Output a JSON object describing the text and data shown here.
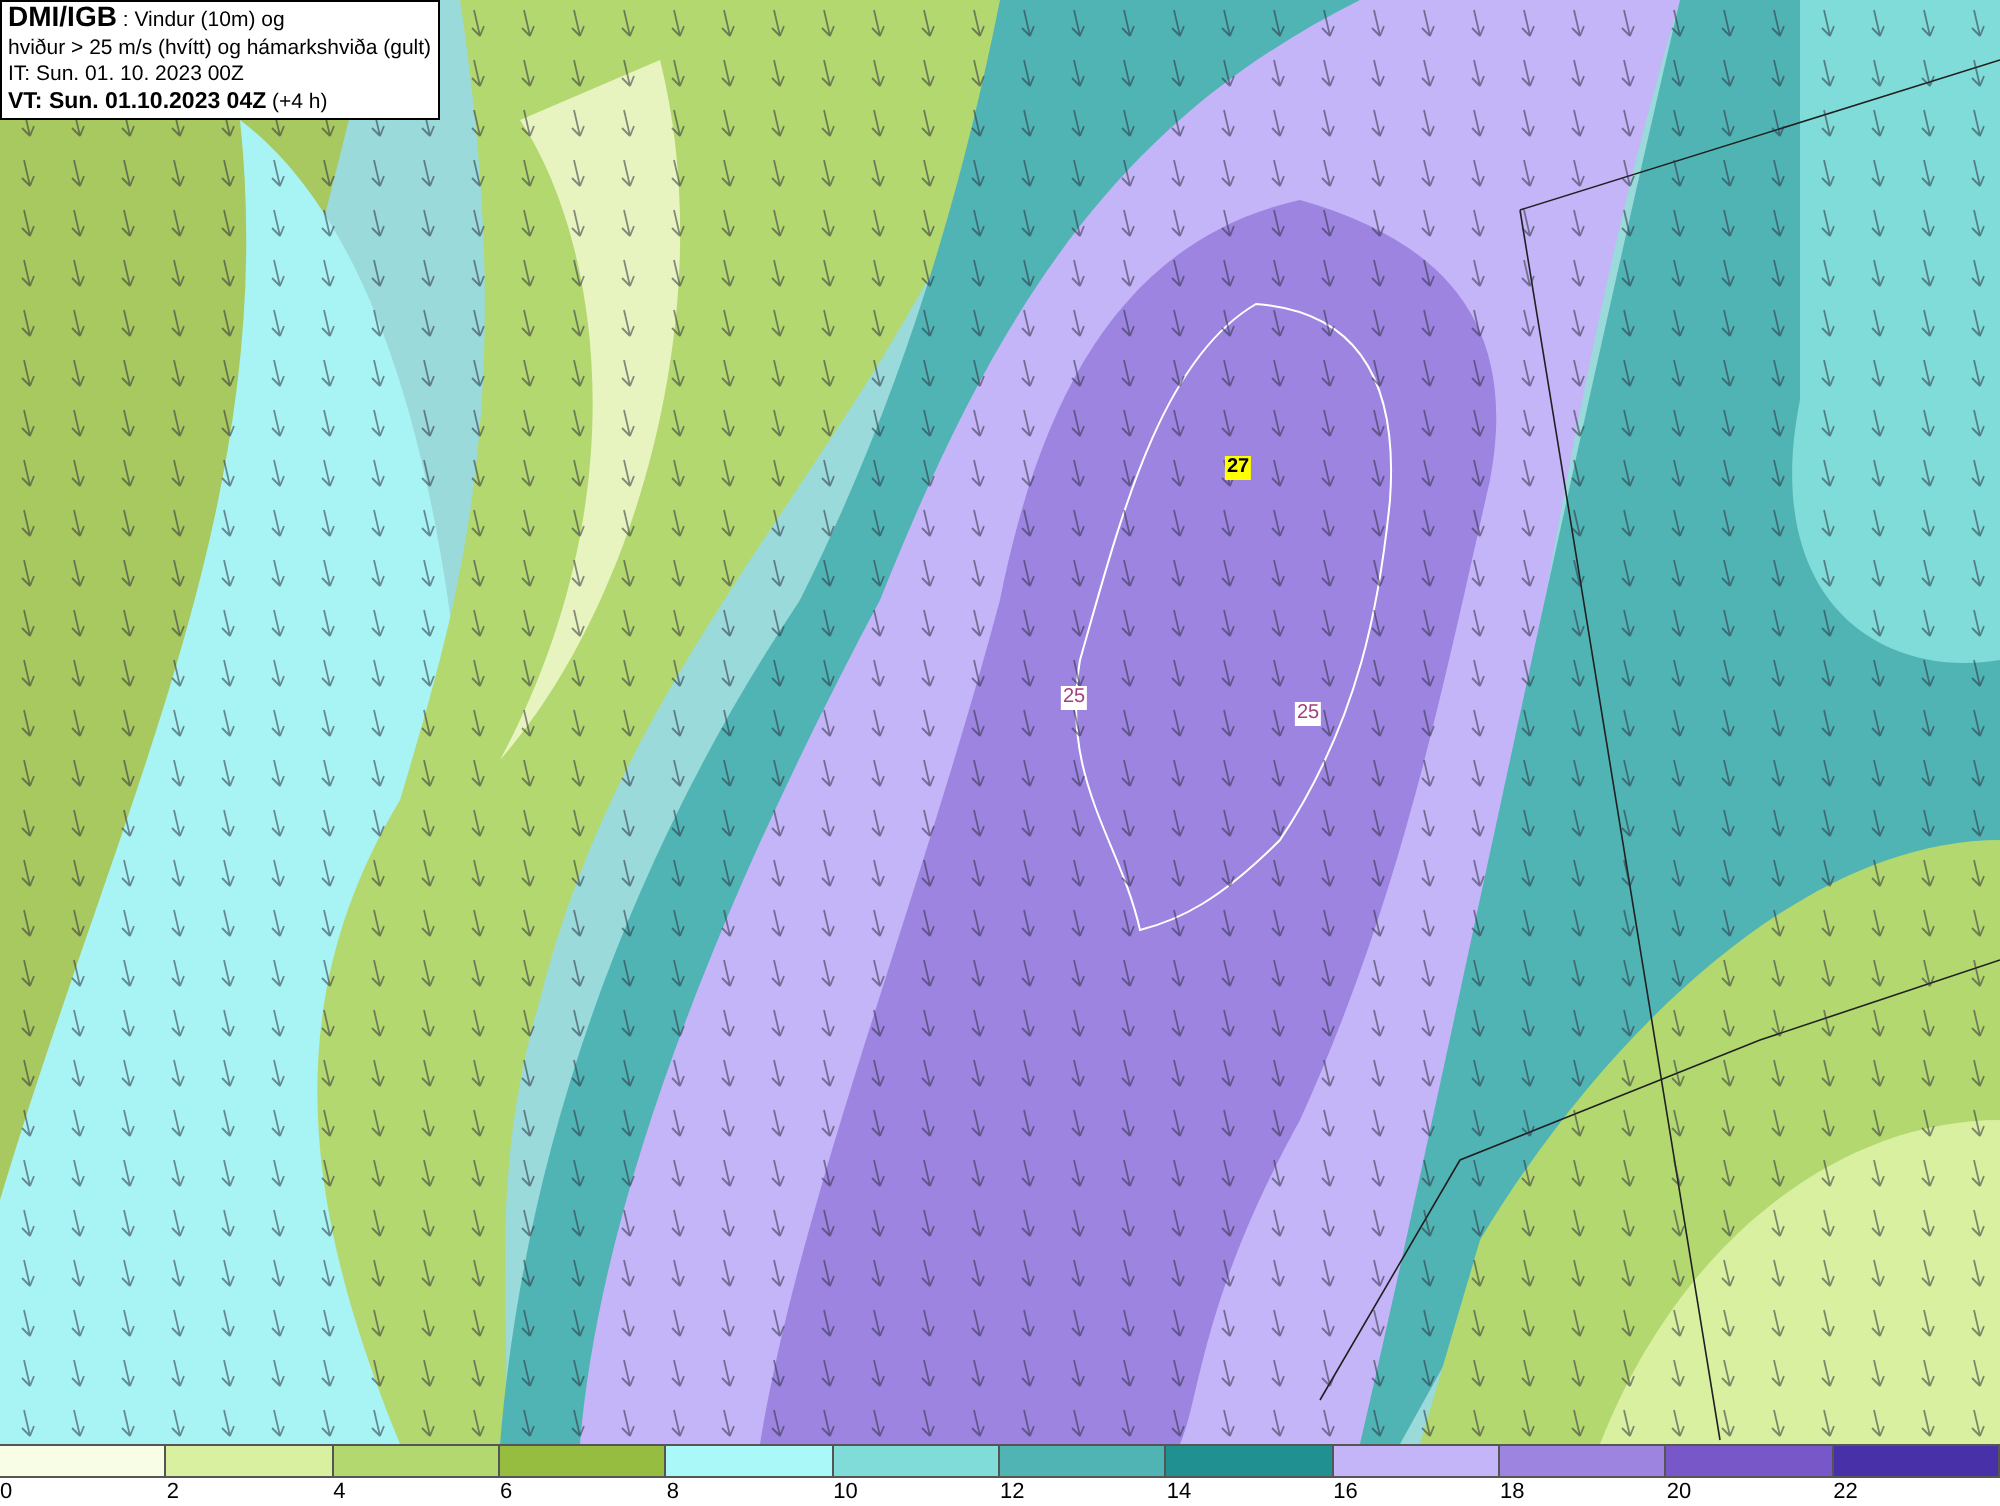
{
  "title_box": {
    "source": "DMI/IGB",
    "line_1": ": Vindur (10m) og",
    "line_2": "hviður > 25 m/s (hvítt) og hámarkshviða (gult)",
    "initial_time": "IT: Sun. 01. 10. 2023 00Z",
    "valid_time": "VT: Sun. 01.10.2023 04Z",
    "offset": "(+4 h)"
  },
  "map": {
    "labels": [
      {
        "text": "27",
        "kind": "max"
      },
      {
        "text": "25",
        "kind": "contour"
      },
      {
        "text": "25",
        "kind": "contour"
      }
    ]
  },
  "legend": {
    "items": [
      {
        "tick": "0",
        "color": "#f8fde6"
      },
      {
        "tick": "2",
        "color": "#d8f0a0"
      },
      {
        "tick": "4",
        "color": "#b4d870"
      },
      {
        "tick": "6",
        "color": "#96bc40"
      },
      {
        "tick": "8",
        "color": "#aaf8f8"
      },
      {
        "tick": "10",
        "color": "#80dcd8"
      },
      {
        "tick": "12",
        "color": "#50b4b4"
      },
      {
        "tick": "14",
        "color": "#209090"
      },
      {
        "tick": "16",
        "color": "#c4b4f8"
      },
      {
        "tick": "18",
        "color": "#9c84e0"
      },
      {
        "tick": "20",
        "color": "#7858c8"
      },
      {
        "tick": "22",
        "color": "#4830a8"
      }
    ]
  }
}
